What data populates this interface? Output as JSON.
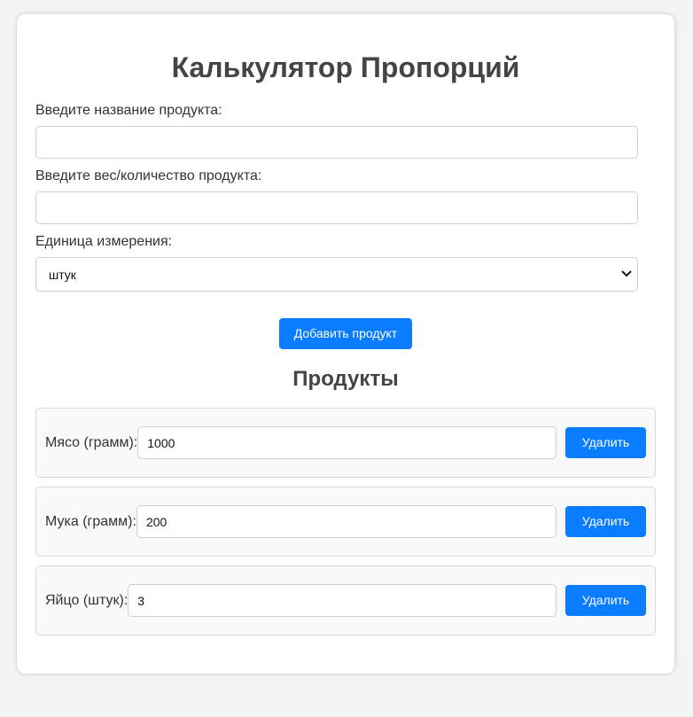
{
  "app": {
    "title": "Калькулятор Пропорций"
  },
  "form": {
    "name_label": "Введите название продукта:",
    "name_value": "",
    "qty_label": "Введите вес/количество продукта:",
    "qty_value": "",
    "unit_label": "Единица измерения:",
    "unit_selected": "штук",
    "add_button": "Добавить продукт"
  },
  "products_section": {
    "title": "Продукты",
    "items": [
      {
        "label": "Мясо (грамм):",
        "value": "1000",
        "delete_label": "Удалить"
      },
      {
        "label": "Мука (грамм):",
        "value": "200",
        "delete_label": "Удалить"
      },
      {
        "label": "Яйцо (штук):",
        "value": "3",
        "delete_label": "Удалить"
      }
    ]
  },
  "colors": {
    "accent": "#0a7cff",
    "background": "#f4f4f4",
    "card": "#ffffff",
    "row_background": "#f9f9f9"
  },
  "icons": {
    "select_arrow": "chevron-down-icon"
  }
}
